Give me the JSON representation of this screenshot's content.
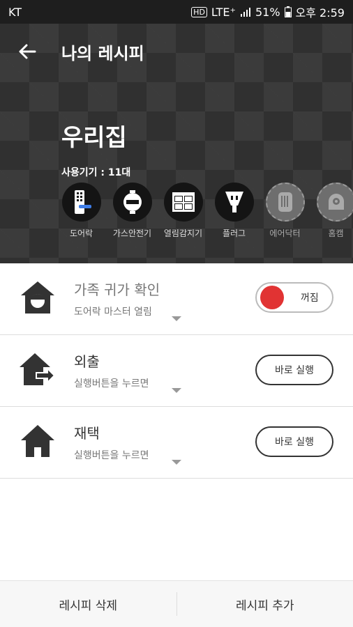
{
  "status_bar": {
    "carrier": "KT",
    "hd": "HD",
    "network": "LTE⁺",
    "battery": "51%",
    "time": "오후 2:59"
  },
  "header": {
    "title": "나의 레시피",
    "home_name": "우리집",
    "device_count": "사용기기 : 11대",
    "devices": [
      {
        "label": "도어락",
        "icon": "door-lock-icon",
        "active": true
      },
      {
        "label": "가스안전기",
        "icon": "gas-safety-icon",
        "active": true
      },
      {
        "label": "열림감지기",
        "icon": "window-sensor-icon",
        "active": true
      },
      {
        "label": "플러그",
        "icon": "plug-icon",
        "active": true
      },
      {
        "label": "에어닥터",
        "icon": "air-doctor-icon",
        "active": false
      },
      {
        "label": "홈캠",
        "icon": "home-cam-icon",
        "active": false
      }
    ]
  },
  "recipes": [
    {
      "title": "가족 귀가 확인",
      "subtitle": "도어락 마스터 열림",
      "icon": "family-home-icon",
      "control": "toggle",
      "control_label": "꺼짐"
    },
    {
      "title": "외출",
      "subtitle": "실행버튼을 누르면",
      "icon": "leave-home-icon",
      "control": "button",
      "control_label": "바로 실행"
    },
    {
      "title": "재택",
      "subtitle": "실행버튼을 누르면",
      "icon": "home-icon",
      "control": "button",
      "control_label": "바로 실행"
    }
  ],
  "bottom_bar": {
    "delete_label": "레시피 삭제",
    "add_label": "레시피 추가"
  },
  "colors": {
    "header_bg": "#303030",
    "toggle_off": "#e13333"
  }
}
